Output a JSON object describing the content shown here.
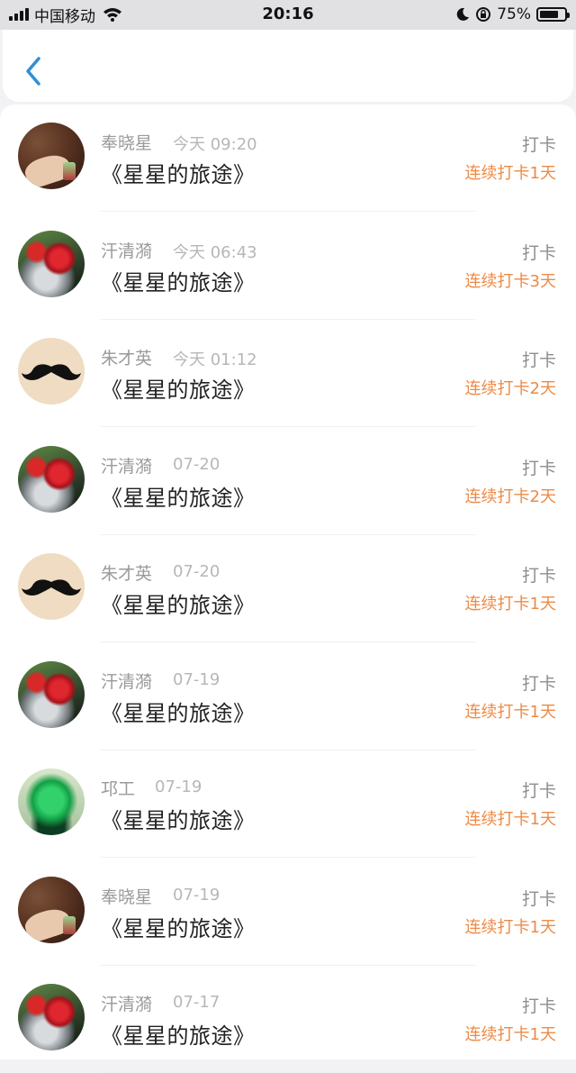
{
  "status_bar": {
    "carrier": "中国移动",
    "time": "20:16",
    "battery_percent": "75%",
    "battery_level": 0.75
  },
  "nav": {
    "back_icon": "chevron-left-icon"
  },
  "colors": {
    "accent": "#2f8fd8",
    "streak": "#ee8a45"
  },
  "list": [
    {
      "name": "奉晓星",
      "time": "今天 09:20",
      "book": "《星星的旅途》",
      "type": "打卡",
      "streak": "连续打卡1天",
      "avatar": "hair"
    },
    {
      "name": "汗清漪",
      "time": "今天 06:43",
      "book": "《星星的旅途》",
      "type": "打卡",
      "streak": "连续打卡3天",
      "avatar": "flower"
    },
    {
      "name": "朱才英",
      "time": "今天 01:12",
      "book": "《星星的旅途》",
      "type": "打卡",
      "streak": "连续打卡2天",
      "avatar": "mustache"
    },
    {
      "name": "汗清漪",
      "time": "07-20",
      "book": "《星星的旅途》",
      "type": "打卡",
      "streak": "连续打卡2天",
      "avatar": "flower"
    },
    {
      "name": "朱才英",
      "time": "07-20",
      "book": "《星星的旅途》",
      "type": "打卡",
      "streak": "连续打卡1天",
      "avatar": "mustache"
    },
    {
      "name": "汗清漪",
      "time": "07-19",
      "book": "《星星的旅途》",
      "type": "打卡",
      "streak": "连续打卡1天",
      "avatar": "flower"
    },
    {
      "name": "邛工",
      "time": "07-19",
      "book": "《星星的旅途》",
      "type": "打卡",
      "streak": "连续打卡1天",
      "avatar": "jade"
    },
    {
      "name": "奉晓星",
      "time": "07-19",
      "book": "《星星的旅途》",
      "type": "打卡",
      "streak": "连续打卡1天",
      "avatar": "hair"
    },
    {
      "name": "汗清漪",
      "time": "07-17",
      "book": "《星星的旅途》",
      "type": "打卡",
      "streak": "连续打卡1天",
      "avatar": "flower"
    }
  ]
}
